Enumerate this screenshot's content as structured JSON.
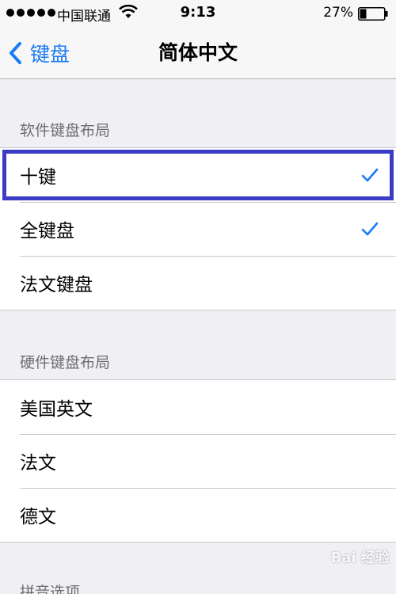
{
  "status_bar": {
    "carrier": "中国联通",
    "time": "9:13",
    "battery_percent": "27%",
    "battery_level": 0.27
  },
  "nav": {
    "back_label": "键盘",
    "title": "简体中文",
    "accent_color": "#1a7cf5"
  },
  "sections": [
    {
      "header": "软件键盘布局",
      "rows": [
        {
          "label": "十键",
          "checked": true
        },
        {
          "label": "全键盘",
          "checked": true
        },
        {
          "label": "法文键盘",
          "checked": false
        }
      ]
    },
    {
      "header": "硬件键盘布局",
      "rows": [
        {
          "label": "美国英文"
        },
        {
          "label": "法文"
        },
        {
          "label": "德文"
        }
      ]
    },
    {
      "header": "拼音选项"
    }
  ],
  "highlight_color": "#3b3bc4",
  "watermark": "Bai 经验"
}
